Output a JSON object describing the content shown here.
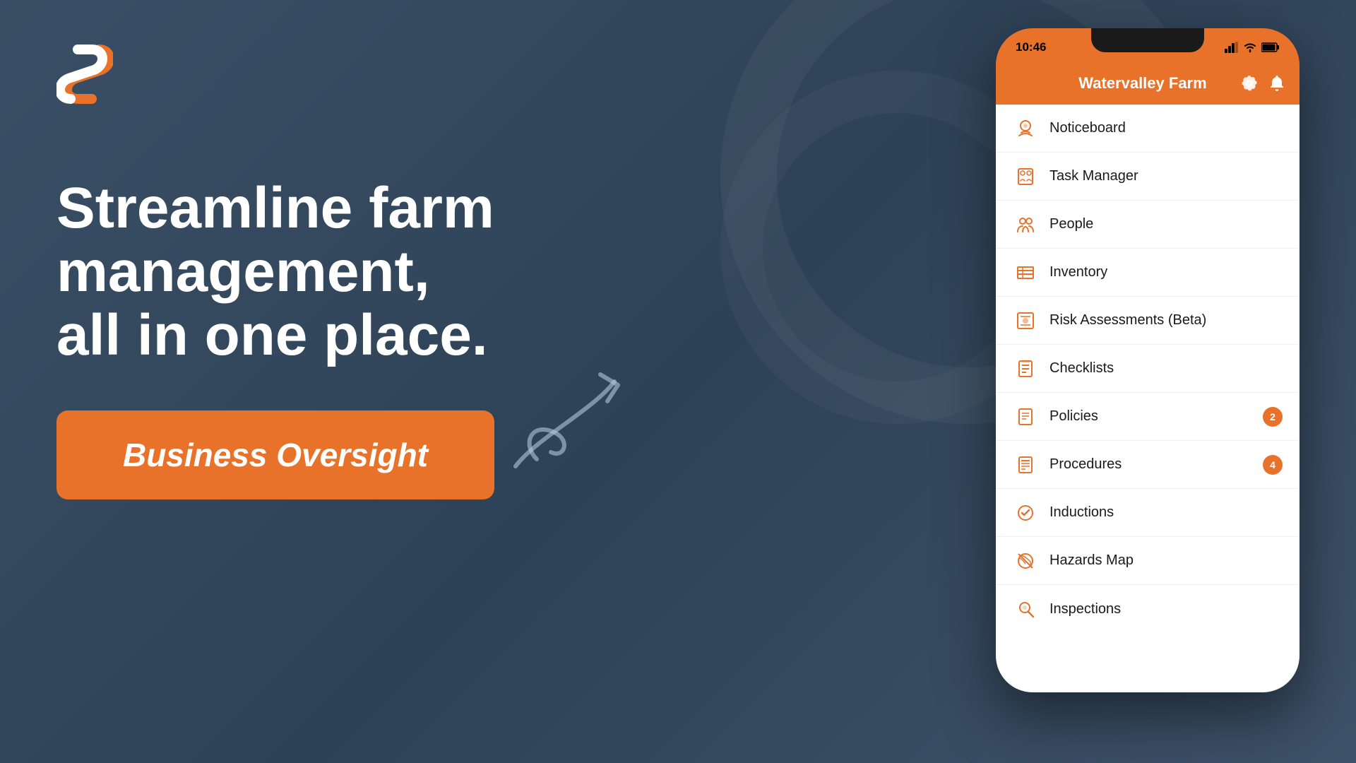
{
  "background": {
    "color": "#3d5168"
  },
  "logo": {
    "alt": "SafeFarm Logo"
  },
  "left": {
    "headline_line1": "Streamline farm",
    "headline_line2": "management,",
    "headline_line3": "all in one place.",
    "cta_label": "Business Oversight"
  },
  "phone": {
    "status_time": "10:46",
    "app_title": "Watervalley Farm",
    "menu_items": [
      {
        "id": "noticeboard",
        "label": "Noticeboard",
        "icon": "noticeboard",
        "badge": null
      },
      {
        "id": "task-manager",
        "label": "Task Manager",
        "icon": "task",
        "badge": null
      },
      {
        "id": "people",
        "label": "People",
        "icon": "people",
        "badge": null
      },
      {
        "id": "inventory",
        "label": "Inventory",
        "icon": "inventory",
        "badge": null
      },
      {
        "id": "risk-assessments",
        "label": "Risk Assessments (Beta)",
        "icon": "risk",
        "badge": null
      },
      {
        "id": "checklists",
        "label": "Checklists",
        "icon": "checklist",
        "badge": null
      },
      {
        "id": "policies",
        "label": "Policies",
        "icon": "policies",
        "badge": "2"
      },
      {
        "id": "procedures",
        "label": "Procedures",
        "icon": "procedures",
        "badge": "4"
      },
      {
        "id": "inductions",
        "label": "Inductions",
        "icon": "inductions",
        "badge": null
      },
      {
        "id": "hazards-map",
        "label": "Hazards Map",
        "icon": "hazards",
        "badge": null
      },
      {
        "id": "inspections",
        "label": "Inspections",
        "icon": "inspections",
        "badge": null
      }
    ]
  }
}
